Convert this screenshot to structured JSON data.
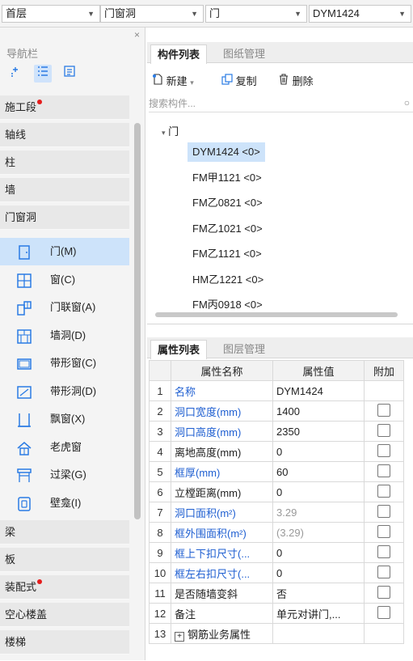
{
  "toolbar": {
    "floor": "首层",
    "category": "门窗洞",
    "type": "门",
    "component": "DYM1424"
  },
  "nav": {
    "close": "×",
    "title": "导航栏",
    "categories_top": [
      {
        "label": "施工段",
        "dot": true
      },
      {
        "label": "轴线",
        "dot": false
      },
      {
        "label": "柱",
        "dot": false
      },
      {
        "label": "墙",
        "dot": false
      },
      {
        "label": "门窗洞",
        "dot": false
      }
    ],
    "sub_items": [
      {
        "label": "门(M)",
        "icon": "door-icon",
        "selected": true
      },
      {
        "label": "窗(C)",
        "icon": "window-icon",
        "selected": false
      },
      {
        "label": "门联窗(A)",
        "icon": "door-window-icon",
        "selected": false
      },
      {
        "label": "墙洞(D)",
        "icon": "wall-opening-icon",
        "selected": false
      },
      {
        "label": "带形窗(C)",
        "icon": "strip-window-icon",
        "selected": false
      },
      {
        "label": "带形洞(D)",
        "icon": "strip-opening-icon",
        "selected": false
      },
      {
        "label": "飘窗(X)",
        "icon": "bay-window-icon",
        "selected": false
      },
      {
        "label": "老虎窗",
        "icon": "dormer-icon",
        "selected": false
      },
      {
        "label": "过梁(G)",
        "icon": "lintel-icon",
        "selected": false
      },
      {
        "label": "壁龛(I)",
        "icon": "niche-icon",
        "selected": false
      }
    ],
    "categories_bottom": [
      {
        "label": "梁",
        "dot": false
      },
      {
        "label": "板",
        "dot": false
      },
      {
        "label": "装配式",
        "dot": true
      },
      {
        "label": "空心楼盖",
        "dot": false
      },
      {
        "label": "楼梯",
        "dot": false
      }
    ]
  },
  "components": {
    "tab_active": "构件列表",
    "tab_inactive": "图纸管理",
    "new_label": "新建",
    "copy_label": "复制",
    "delete_label": "删除",
    "search_placeholder": "搜索构件...",
    "tree_root": "门",
    "items": [
      {
        "label": "DYM1424 <0>",
        "selected": true
      },
      {
        "label": "FM甲1121 <0>",
        "selected": false
      },
      {
        "label": "FM乙0821 <0>",
        "selected": false
      },
      {
        "label": "FM乙1021 <0>",
        "selected": false
      },
      {
        "label": "FM乙1121 <0>",
        "selected": false
      },
      {
        "label": "HM乙1221 <0>",
        "selected": false
      },
      {
        "label": "FM丙0918 <0>",
        "selected": false
      }
    ]
  },
  "properties": {
    "tab_active": "属性列表",
    "tab_inactive": "图层管理",
    "col_name": "属性名称",
    "col_value": "属性值",
    "col_extra": "附加",
    "rows": [
      {
        "idx": "1",
        "name": "名称",
        "value": "DYM1424",
        "style": "blue",
        "vstyle": "",
        "checkbox": false
      },
      {
        "idx": "2",
        "name": "洞口宽度(mm)",
        "value": "1400",
        "style": "blue",
        "vstyle": "",
        "checkbox": true
      },
      {
        "idx": "3",
        "name": "洞口高度(mm)",
        "value": "2350",
        "style": "blue",
        "vstyle": "",
        "checkbox": true
      },
      {
        "idx": "4",
        "name": "离地高度(mm)",
        "value": "0",
        "style": "",
        "vstyle": "",
        "checkbox": true
      },
      {
        "idx": "5",
        "name": "框厚(mm)",
        "value": "60",
        "style": "blue",
        "vstyle": "",
        "checkbox": true
      },
      {
        "idx": "6",
        "name": "立樘距离(mm)",
        "value": "0",
        "style": "",
        "vstyle": "",
        "checkbox": true
      },
      {
        "idx": "7",
        "name": "洞口面积(m²)",
        "value": "3.29",
        "style": "blue",
        "vstyle": "grey",
        "checkbox": true
      },
      {
        "idx": "8",
        "name": "框外围面积(m²)",
        "value": "(3.29)",
        "style": "blue",
        "vstyle": "grey",
        "checkbox": true
      },
      {
        "idx": "9",
        "name": "框上下扣尺寸(...",
        "value": "0",
        "style": "blue",
        "vstyle": "",
        "checkbox": true
      },
      {
        "idx": "10",
        "name": "框左右扣尺寸(...",
        "value": "0",
        "style": "blue",
        "vstyle": "",
        "checkbox": true
      },
      {
        "idx": "11",
        "name": "是否随墙变斜",
        "value": "否",
        "style": "",
        "vstyle": "",
        "checkbox": true
      },
      {
        "idx": "12",
        "name": "备注",
        "value": "单元对讲门,...",
        "style": "",
        "vstyle": "",
        "checkbox": true
      },
      {
        "idx": "13",
        "name": "钢筋业务属性",
        "value": "",
        "style": "",
        "vstyle": "",
        "checkbox": false,
        "expand": true
      }
    ]
  },
  "colors": {
    "accent": "#2a7be4",
    "selected_bg": "#cde3fa",
    "dot": "#e51c1c",
    "link_blue": "#1f5fd1"
  }
}
